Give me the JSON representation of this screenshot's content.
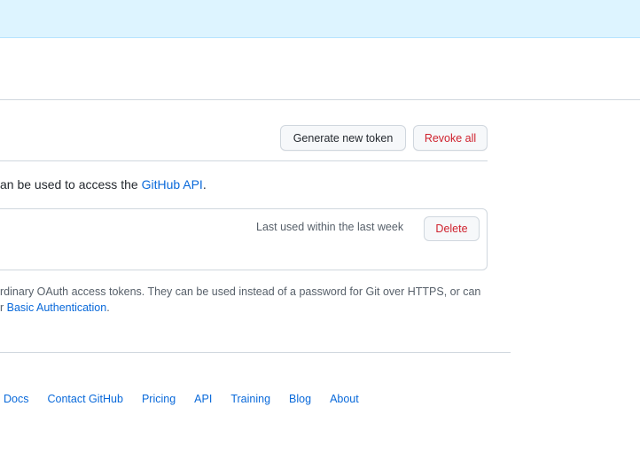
{
  "buttons": {
    "generate": "Generate new token",
    "revoke": "Revoke all",
    "delete": "Delete"
  },
  "intro": {
    "prefix": "an be used to access the ",
    "link": "GitHub API",
    "suffix": "."
  },
  "token": {
    "last_used": "Last used within the last week"
  },
  "note": {
    "line1": "rdinary OAuth access tokens. They can be used instead of a password for Git over HTTPS, or can",
    "line2_prefix": "r ",
    "line2_link": "Basic Authentication",
    "line2_suffix": "."
  },
  "footer": {
    "links": [
      "Docs",
      "Contact GitHub",
      "Pricing",
      "API",
      "Training",
      "Blog",
      "About"
    ]
  },
  "colors": {
    "link": "#0969da",
    "danger": "#cf222e",
    "banner": "#ddf4ff"
  }
}
